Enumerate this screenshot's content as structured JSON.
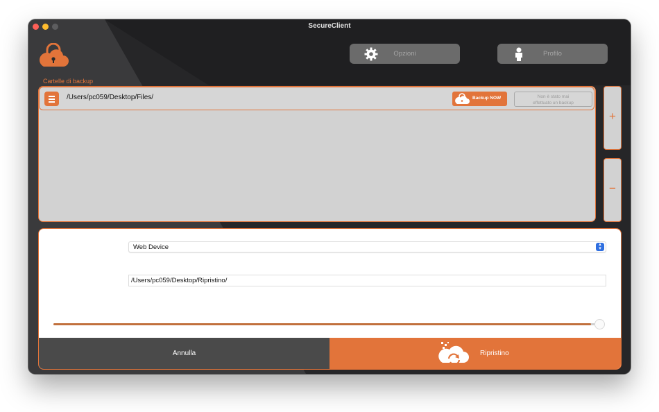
{
  "window": {
    "title": "SecureClient"
  },
  "toolbar": {
    "options_label": "Opzioni",
    "options_icon": "gear-icon",
    "profile_label": "Profilo",
    "profile_icon": "person-icon",
    "logo_icon": "cloud-lock-icon"
  },
  "backup_folders": {
    "section_label": "Cartelle di backup",
    "items": [
      {
        "path": "/Users/pc059/Desktop/Files/",
        "backup_button_label": "Backup NOW",
        "status_line1": "Non è stato mai",
        "status_line2": "effettuato un backup"
      }
    ],
    "add_label": "+",
    "remove_label": "−"
  },
  "restore": {
    "source_selected": "Web Device",
    "destination_value": "/Users/pc059/Desktop/Ripristino/",
    "progress_fraction": 0.98,
    "cancel_label": "Annulla",
    "restore_label": "Ripristino"
  },
  "colors": {
    "accent": "#e2743a",
    "window_bg": "#3a3a3c",
    "panel_bg": "#d2d2d2",
    "cancel_bg": "#4a4a4a"
  }
}
